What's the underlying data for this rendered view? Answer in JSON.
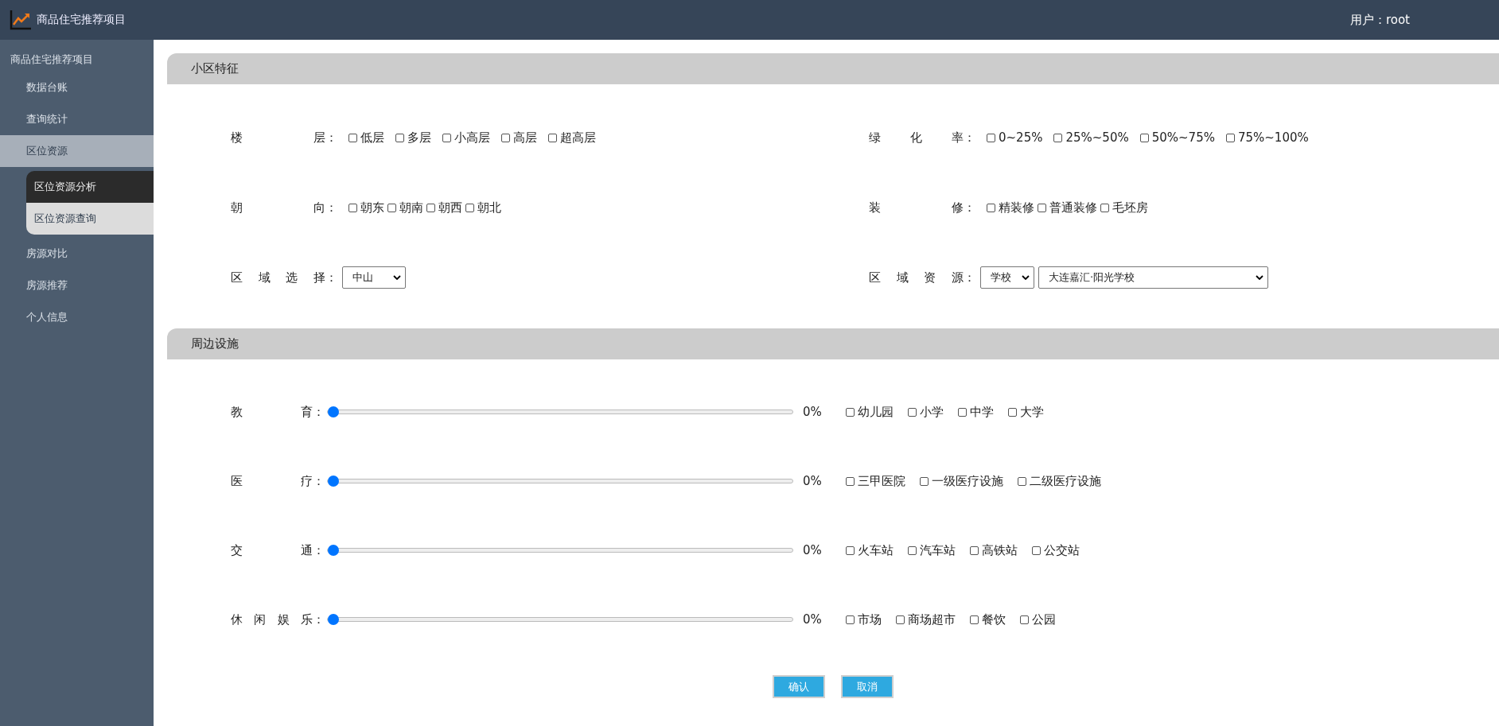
{
  "header": {
    "title": "商品住宅推荐项目",
    "user": "用户：root"
  },
  "sidebar": {
    "title": "商品住宅推荐项目",
    "items": [
      {
        "label": "数据台账",
        "selected": false
      },
      {
        "label": "查询统计",
        "selected": false
      },
      {
        "label": "区位资源",
        "selected": true,
        "children": [
          {
            "label": "区位资源分析",
            "selected": false
          },
          {
            "label": "区位资源查询",
            "selected": true
          }
        ]
      },
      {
        "label": "房源对比",
        "selected": false
      },
      {
        "label": "房源推荐",
        "selected": false
      },
      {
        "label": "个人信息",
        "selected": false
      }
    ]
  },
  "community_section": {
    "title": "小区特征",
    "fields": [
      {
        "kind": "checkboxes",
        "label": "楼层：",
        "options": [
          {
            "label": "低层",
            "checked": false
          },
          {
            "label": "多层",
            "checked": false
          },
          {
            "label": "小高层",
            "checked": false
          },
          {
            "label": "高层",
            "checked": false
          },
          {
            "label": "超高层",
            "checked": false
          }
        ]
      },
      {
        "kind": "checkboxes",
        "label": "绿化率：",
        "options": [
          {
            "label": "0~25%",
            "checked": false
          },
          {
            "label": "25%~50%",
            "checked": false
          },
          {
            "label": "50%~75%",
            "checked": false
          },
          {
            "label": "75%~100%",
            "checked": false
          }
        ]
      },
      {
        "kind": "checkboxes",
        "label": "朝向：",
        "options": [
          {
            "label": "朝东",
            "checked": false
          },
          {
            "label": "朝南",
            "checked": false
          },
          {
            "label": "朝西",
            "checked": false
          },
          {
            "label": "朝北",
            "checked": false
          }
        ]
      },
      {
        "kind": "checkboxes",
        "label": "装修：",
        "options": [
          {
            "label": "精装修",
            "checked": false
          },
          {
            "label": "普通装修",
            "checked": false
          },
          {
            "label": "毛坯房",
            "checked": false
          }
        ]
      },
      {
        "kind": "selects",
        "label": "区域选择：",
        "selects": [
          {
            "value": "中山"
          }
        ]
      },
      {
        "kind": "selects",
        "label": "区域资源：",
        "selects": [
          {
            "value": "学校"
          },
          {
            "value": "大连嘉汇·阳光学校"
          }
        ]
      }
    ]
  },
  "facilities_section": {
    "title": "周边设施",
    "rows": [
      {
        "label": "教育：",
        "level": 0,
        "reading": "0%",
        "options": [
          {
            "label": "幼儿园",
            "checked": false
          },
          {
            "label": "小学",
            "checked": false
          },
          {
            "label": "中学",
            "checked": false
          },
          {
            "label": "大学",
            "checked": false
          }
        ]
      },
      {
        "label": "医疗：",
        "level": 0,
        "reading": "0%",
        "options": [
          {
            "label": "三甲医院",
            "checked": false
          },
          {
            "label": "一级医疗设施",
            "checked": false
          },
          {
            "label": "二级医疗设施",
            "checked": false
          }
        ]
      },
      {
        "label": "交通：",
        "level": 0,
        "reading": "0%",
        "options": [
          {
            "label": "火车站",
            "checked": false
          },
          {
            "label": "汽车站",
            "checked": false
          },
          {
            "label": "高铁站",
            "checked": false
          },
          {
            "label": "公交站",
            "checked": false
          }
        ]
      },
      {
        "label": "休闲娱乐：",
        "level": 0,
        "reading": "0%",
        "options": [
          {
            "label": "市场",
            "checked": false
          },
          {
            "label": "商场超市",
            "checked": false
          },
          {
            "label": "餐饮",
            "checked": false
          },
          {
            "label": "公园",
            "checked": false
          }
        ]
      }
    ]
  },
  "buttons": [
    {
      "label": "确认"
    },
    {
      "label": "取消"
    }
  ]
}
